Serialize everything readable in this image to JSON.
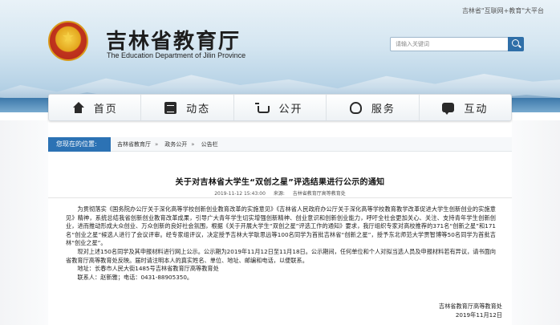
{
  "header": {
    "top_link": "吉林省\"互联网+教育\"大平台",
    "site_title": "吉林省教育厅",
    "site_subtitle": "The Education Department of Jilin Province",
    "search_placeholder": "请输入关键词"
  },
  "nav": {
    "items": [
      {
        "label": "首页",
        "icon": "home-icon"
      },
      {
        "label": "动态",
        "icon": "news-icon"
      },
      {
        "label": "公开",
        "icon": "cart-icon"
      },
      {
        "label": "服务",
        "icon": "handshake-icon"
      },
      {
        "label": "互动",
        "icon": "chat-icon"
      }
    ]
  },
  "breadcrumb": {
    "here_label": "您现在的位置:",
    "items": [
      "吉林省教育厅",
      "政务公开",
      "公告栏"
    ],
    "separator": "»"
  },
  "article": {
    "title": "关于对吉林省大学生“双创之星”评选结果进行公示的通知",
    "date": "2019-11-12 15:43:00",
    "source": "来源:",
    "dept": "吉林省教育厅高等教育处",
    "paragraphs": [
      "为贯彻落实《国务院办公厅关于深化高等学校创新创业教育改革的实施意见》《吉林省人民政府办公厅关于深化高等学校教育教学改革促进大学生创新创业的实施意见》精神，系统总结我省创新创业教育改革成果，引导广大青年学生切实增强创新精神、创业意识和创新创业能力，呼吁全社会更加关心、关注、支持青年学生创新创业，进而推动形成大众创业、万众创新的良好社会氛围，根据《关于开展大学生“双创之星”评选工作的通知》要求，我厅组织专家对高校推荐的371名“创新之星”和171名“创业之星”候选人进行了会议评审。经专家组评议，决定授予吉林大学耿思远等100名同学为首批吉林省“创新之星”，授予东北师范大学贾智博等50名同学为首批吉林“创业之星”。",
      "现对上述150名同学及其申报材料进行网上公示。公示期为2019年11月12日至11月18日。公示期间，任何单位和个人对拟当选人员及申报材料若有异议，请书面向省教育厅高等教育处反映。届时请注明本人的真实姓名、单位、地址、邮编和电话，以便联系。",
      "地址：长春市人民大街1485号吉林省教育厅高等教育处",
      "联系人：赵新雅；电话：0431-88905350。"
    ],
    "signature": "吉林省教育厅高等教育处",
    "sign_date": "2019年11月12日"
  }
}
